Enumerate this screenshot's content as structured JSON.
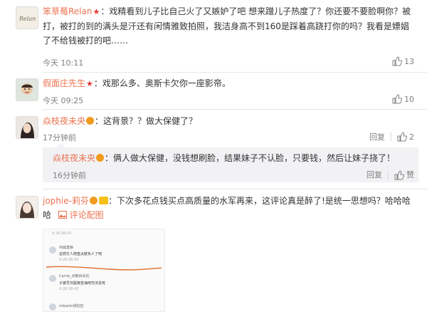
{
  "comments": [
    {
      "username": "笨草莓Relan",
      "text": "：戏精看到儿子比自己火了又嫉妒了吧 想来蹭儿子热度了？你还要不要脸啊你？被打，被打的到的满头是汗还有闲情雅致拍照，我洁身高不到160是踩着高跷打你的吗？我看是嫖娼了不给钱被打的吧……",
      "time": "今天 10:11",
      "likes": "13"
    },
    {
      "username": "假面庄先生",
      "text": "：戏那么多、奥斯卡欠你一座影帝。",
      "time": "今天 09:25",
      "likes": "10"
    },
    {
      "username": "焱枝夜未央",
      "text": "：这背景？？做大保健了？",
      "time": "17分钟前",
      "reply_label": "回复",
      "likes": "2",
      "sub_reply": {
        "username": "焱枝夜未央",
        "text": "：俩人做大保健，没钱想刷脸，结果妹子不认脸，只要钱，然后让妹子挠了！",
        "time": "16分钟前",
        "reply_label": "回复",
        "like_label": "赞"
      }
    },
    {
      "username": "jophie-莉芬",
      "text": "：下次多花点钱买点高质量的水军再来，这评论真是醉了!是统一思想吗？哈哈哈哈",
      "pic_link": "评论配图",
      "screenshot": {
        "lines": [
          "9-26 08:43",
          "何威衷麻",
          "这样打人随直太欺负人了吧",
          "9-26 08:43",
          "Carrie_点教目出氏",
          "子彼早日脱离苦海吧司法去死",
          "9-26 08:43",
          "mikaimi通迎应"
        ]
      }
    }
  ],
  "colors": {
    "username": "#eb7350",
    "meta": "#808080",
    "reply_bg": "#f2f2f5"
  }
}
